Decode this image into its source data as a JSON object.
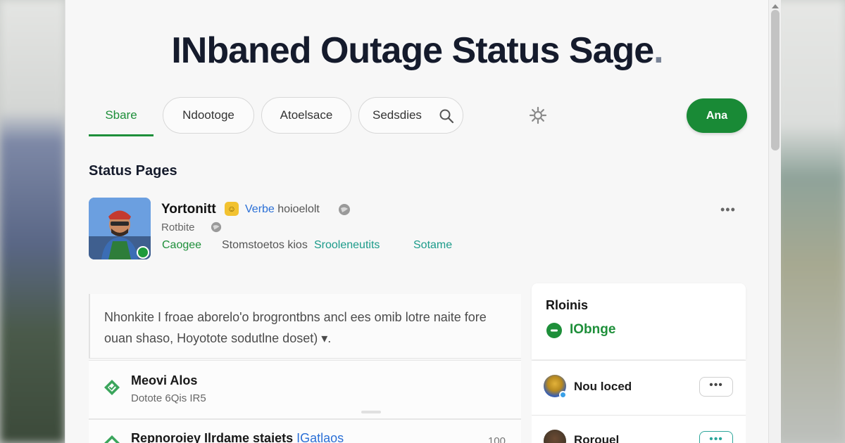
{
  "page": {
    "title": "INbaned Outage Status Sage",
    "title_dot": "."
  },
  "nav": {
    "active_tab": "Sbare",
    "pills": [
      "Ndootoge",
      "Atoelsace",
      "Sedsdies"
    ],
    "add_button": "Ana",
    "accent_color": "#1e8f3a"
  },
  "section": {
    "heading": "Status Pages"
  },
  "profile": {
    "name": "Yortonitt",
    "verify_main": "Verbe",
    "verify_rest": " hoioelolt",
    "sub": "Rotbite",
    "links": [
      "Caogee",
      "Stomstoetos kios",
      "Srooleneutits",
      "Sotame"
    ],
    "more": "•••"
  },
  "description": {
    "text": "Nhonkite I froae aborelo'o brogrontbns ancl ees omib lotre naite fore ouan shaso, Hoyotote sodutlne doset) ▾."
  },
  "list": {
    "rows": [
      {
        "title": "Meovi Alos",
        "sub": "Dotote 6Qis IR5",
        "count": ""
      },
      {
        "title": "Repnoroiey Ilrdame staiets ",
        "title_accent": "IGatlaos",
        "sub": "",
        "count": "100"
      }
    ]
  },
  "panel": {
    "title": "Rloinis",
    "status": "IObnge",
    "status_color": "#1e8f3a",
    "rows": [
      {
        "name": "Nou loced",
        "menu": "•••"
      },
      {
        "name": "Rorouel",
        "menu": "•••"
      }
    ]
  }
}
